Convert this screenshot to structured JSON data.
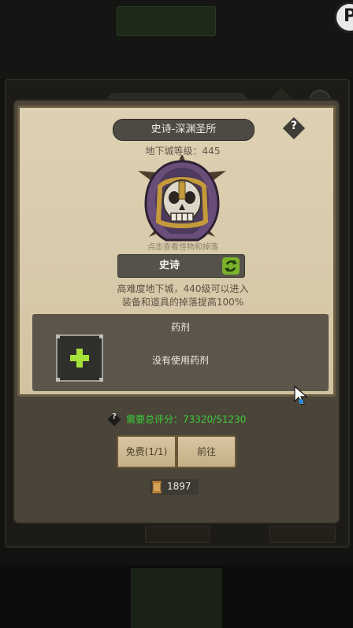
{
  "dialog": {
    "stage_name": "史诗-深渊圣所",
    "help_symbol": "?",
    "dungeon_level_text": "地下城等级：445",
    "hint_text": "点击查看怪物和掉落",
    "difficulty_label": "史诗",
    "description_line1": "高难度地下城，440级可以进入",
    "description_line2": "装备和道具的掉落提高100%",
    "potion_title": "药剂",
    "potion_status": "没有使用药剂",
    "score_help_symbol": "?",
    "score_text": "需要总评分：73320/51230",
    "free_button_label": "免费(1/1)",
    "go_button_label": "前往",
    "cost_value": "1897"
  },
  "colors": {
    "score_green": "#3ccf3c",
    "refresh_green": "#7bb12c",
    "plus_green": "#a6e23a"
  },
  "icons": [
    "help-icon",
    "skull-helmet-icon",
    "refresh-icon",
    "plus-icon",
    "scroll-icon",
    "cursor-icon"
  ]
}
